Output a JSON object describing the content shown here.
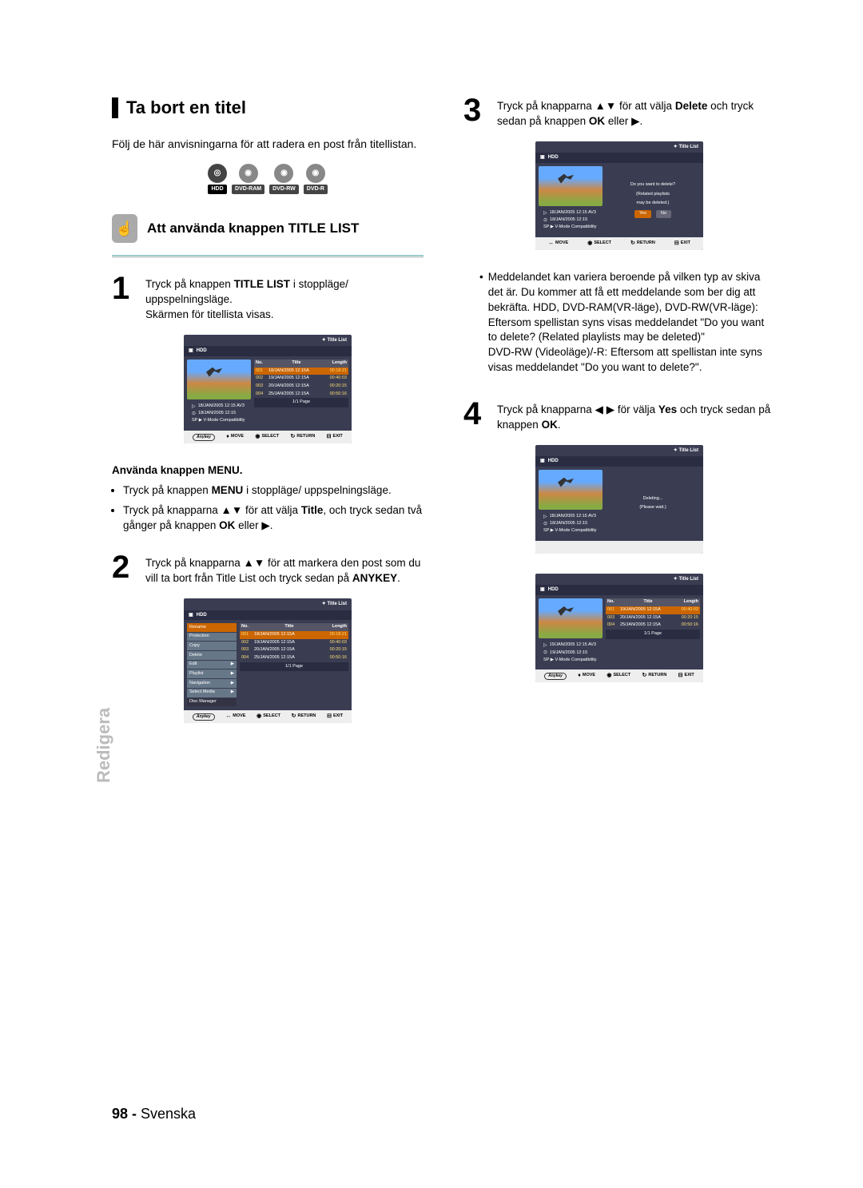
{
  "section_title": "Ta bort en titel",
  "intro": "Följ de här anvisningarna för att radera en post från titellistan.",
  "disc_badges": [
    "HDD",
    "DVD-RAM",
    "DVD-RW",
    "DVD-R"
  ],
  "sub_heading": "Att använda knappen TITLE LIST",
  "step1": {
    "num": "1",
    "line1_a": "Tryck på knappen ",
    "line1_b": "TITLE LIST",
    "line1_c": " i stoppläge/ uppspelningsläge.",
    "line2": "Skärmen för titellista visas."
  },
  "menu_block": {
    "title": "Använda knappen MENU.",
    "b1_a": "Tryck på knappen ",
    "b1_b": "MENU",
    "b1_c": " i stoppläge/ uppspelningsläge.",
    "b2_a": "Tryck på knapparna ▲▼ för att välja ",
    "b2_b": "Title",
    "b2_c": ", och tryck sedan två gånger på knappen ",
    "b2_d": "OK",
    "b2_e": " eller ▶."
  },
  "step2": {
    "num": "2",
    "a": "Tryck på knapparna ▲▼ för att markera den post som du vill ta bort från Title List och tryck sedan på ",
    "b": "ANYKEY",
    "c": "."
  },
  "step3": {
    "num": "3",
    "a": "Tryck på knapparna ▲▼ för att välja ",
    "b": "Delete",
    "c": " och tryck sedan på knappen ",
    "d": "OK",
    "e": " eller ▶."
  },
  "note3": {
    "p1": "Meddelandet kan variera beroende på vilken typ av skiva det är. Du kommer att få ett meddelande som ber dig att bekräfta. HDD, DVD-RAM(VR-läge), DVD-RW(VR-läge): Eftersom spellistan syns visas meddelandet \"Do you want to delete? (Related playlists may be deleted)\"",
    "p2": "DVD-RW (Videoläge)/-R: Eftersom att spellistan inte syns visas meddelandet \"Do you want to delete?\"."
  },
  "step4": {
    "num": "4",
    "a": "Tryck på knapparna ◀ ▶ för välja ",
    "b": "Yes",
    "c": " och tryck sedan på knappen ",
    "d": "OK",
    "e": "."
  },
  "screen_common": {
    "title_list": "Title List",
    "hdd": "HDD",
    "headers": {
      "no": "No.",
      "title": "Title",
      "length": "Length"
    },
    "page": "1/1 Page",
    "anykey": "Anykey",
    "move": "MOVE",
    "select": "SELECT",
    "return": "RETURN",
    "exit": "EXIT",
    "info_line1": "18/JAN/2005 12:15 AV3",
    "info_line2": "18/JAN/2005 12:15",
    "info_line3": "SP ▶ V-Mode Compatibility"
  },
  "screen1_rows": [
    {
      "no": "001",
      "title": "18/JAN/2005 12:15A",
      "len": "00:18:21",
      "sel": true
    },
    {
      "no": "002",
      "title": "19/JAN/2005 12:15A",
      "len": "00:40:03"
    },
    {
      "no": "003",
      "title": "20/JAN/2005 12:15A",
      "len": "00:20:15"
    },
    {
      "no": "004",
      "title": "25/JAN/2005 12:15A",
      "len": "00:50:16"
    }
  ],
  "screen2_menu": [
    "Rename",
    "Protection",
    "Copy",
    "Delete",
    "Edit",
    "Playlist",
    "Navigation",
    "Select Media",
    "Disc Manager"
  ],
  "screen2_rows": [
    {
      "no": "001",
      "title": "18/JAN/2005 12:15A",
      "len": "00:18:21",
      "sel": true
    },
    {
      "no": "002",
      "title": "19/JAN/2005 12:15A",
      "len": "00:40:03"
    },
    {
      "no": "003",
      "title": "20/JAN/2005 12:15A",
      "len": "00:20:15"
    },
    {
      "no": "004",
      "title": "25/JAN/2005 12:15A",
      "len": "00:50:16"
    }
  ],
  "screen3_dialog": {
    "l1": "Do you want to delete?",
    "l2": "(Related playlists",
    "l3": "may be deleted.)",
    "yes": "Yes",
    "no": "No"
  },
  "screen4_dialog": {
    "l1": "Deleting...",
    "l2": "(Please wait.)"
  },
  "screen5_rows": [
    {
      "no": "001",
      "title": "19/JAN/2005 12:15A",
      "len": "00:40:03",
      "sel": true
    },
    {
      "no": "003",
      "title": "20/JAN/2005 12:15A",
      "len": "00:20:15"
    },
    {
      "no": "004",
      "title": "25/JAN/2005 12:15A",
      "len": "00:50:16"
    }
  ],
  "screen5_info": {
    "info_line1": "19/JAN/2005 12:15 AV3",
    "info_line2": "19/JAN/2005 12:15"
  },
  "side_tab": "Redigera",
  "footer": {
    "num": "98 -",
    "lang": " Svenska"
  }
}
